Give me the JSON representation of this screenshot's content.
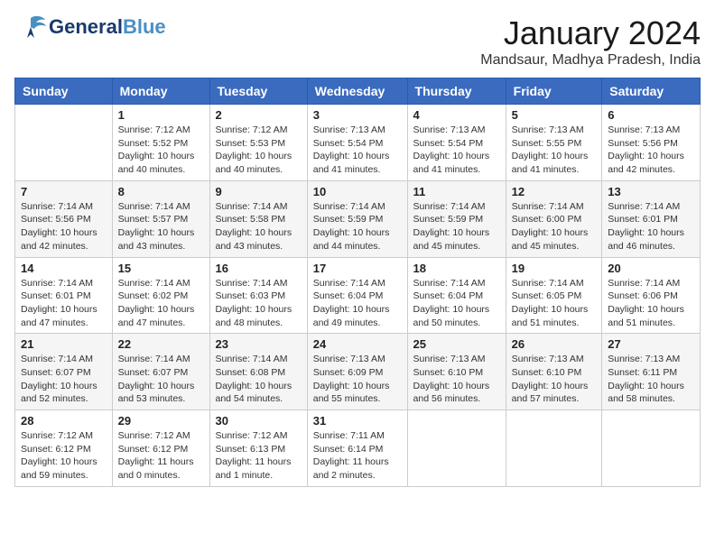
{
  "logo": {
    "line1": "General",
    "line2": "Blue"
  },
  "title": "January 2024",
  "location": "Mandsaur, Madhya Pradesh, India",
  "headers": [
    "Sunday",
    "Monday",
    "Tuesday",
    "Wednesday",
    "Thursday",
    "Friday",
    "Saturday"
  ],
  "weeks": [
    [
      {
        "day": "",
        "info": ""
      },
      {
        "day": "1",
        "info": "Sunrise: 7:12 AM\nSunset: 5:52 PM\nDaylight: 10 hours\nand 40 minutes."
      },
      {
        "day": "2",
        "info": "Sunrise: 7:12 AM\nSunset: 5:53 PM\nDaylight: 10 hours\nand 40 minutes."
      },
      {
        "day": "3",
        "info": "Sunrise: 7:13 AM\nSunset: 5:54 PM\nDaylight: 10 hours\nand 41 minutes."
      },
      {
        "day": "4",
        "info": "Sunrise: 7:13 AM\nSunset: 5:54 PM\nDaylight: 10 hours\nand 41 minutes."
      },
      {
        "day": "5",
        "info": "Sunrise: 7:13 AM\nSunset: 5:55 PM\nDaylight: 10 hours\nand 41 minutes."
      },
      {
        "day": "6",
        "info": "Sunrise: 7:13 AM\nSunset: 5:56 PM\nDaylight: 10 hours\nand 42 minutes."
      }
    ],
    [
      {
        "day": "7",
        "info": "Sunrise: 7:14 AM\nSunset: 5:56 PM\nDaylight: 10 hours\nand 42 minutes."
      },
      {
        "day": "8",
        "info": "Sunrise: 7:14 AM\nSunset: 5:57 PM\nDaylight: 10 hours\nand 43 minutes."
      },
      {
        "day": "9",
        "info": "Sunrise: 7:14 AM\nSunset: 5:58 PM\nDaylight: 10 hours\nand 43 minutes."
      },
      {
        "day": "10",
        "info": "Sunrise: 7:14 AM\nSunset: 5:59 PM\nDaylight: 10 hours\nand 44 minutes."
      },
      {
        "day": "11",
        "info": "Sunrise: 7:14 AM\nSunset: 5:59 PM\nDaylight: 10 hours\nand 45 minutes."
      },
      {
        "day": "12",
        "info": "Sunrise: 7:14 AM\nSunset: 6:00 PM\nDaylight: 10 hours\nand 45 minutes."
      },
      {
        "day": "13",
        "info": "Sunrise: 7:14 AM\nSunset: 6:01 PM\nDaylight: 10 hours\nand 46 minutes."
      }
    ],
    [
      {
        "day": "14",
        "info": "Sunrise: 7:14 AM\nSunset: 6:01 PM\nDaylight: 10 hours\nand 47 minutes."
      },
      {
        "day": "15",
        "info": "Sunrise: 7:14 AM\nSunset: 6:02 PM\nDaylight: 10 hours\nand 47 minutes."
      },
      {
        "day": "16",
        "info": "Sunrise: 7:14 AM\nSunset: 6:03 PM\nDaylight: 10 hours\nand 48 minutes."
      },
      {
        "day": "17",
        "info": "Sunrise: 7:14 AM\nSunset: 6:04 PM\nDaylight: 10 hours\nand 49 minutes."
      },
      {
        "day": "18",
        "info": "Sunrise: 7:14 AM\nSunset: 6:04 PM\nDaylight: 10 hours\nand 50 minutes."
      },
      {
        "day": "19",
        "info": "Sunrise: 7:14 AM\nSunset: 6:05 PM\nDaylight: 10 hours\nand 51 minutes."
      },
      {
        "day": "20",
        "info": "Sunrise: 7:14 AM\nSunset: 6:06 PM\nDaylight: 10 hours\nand 51 minutes."
      }
    ],
    [
      {
        "day": "21",
        "info": "Sunrise: 7:14 AM\nSunset: 6:07 PM\nDaylight: 10 hours\nand 52 minutes."
      },
      {
        "day": "22",
        "info": "Sunrise: 7:14 AM\nSunset: 6:07 PM\nDaylight: 10 hours\nand 53 minutes."
      },
      {
        "day": "23",
        "info": "Sunrise: 7:14 AM\nSunset: 6:08 PM\nDaylight: 10 hours\nand 54 minutes."
      },
      {
        "day": "24",
        "info": "Sunrise: 7:13 AM\nSunset: 6:09 PM\nDaylight: 10 hours\nand 55 minutes."
      },
      {
        "day": "25",
        "info": "Sunrise: 7:13 AM\nSunset: 6:10 PM\nDaylight: 10 hours\nand 56 minutes."
      },
      {
        "day": "26",
        "info": "Sunrise: 7:13 AM\nSunset: 6:10 PM\nDaylight: 10 hours\nand 57 minutes."
      },
      {
        "day": "27",
        "info": "Sunrise: 7:13 AM\nSunset: 6:11 PM\nDaylight: 10 hours\nand 58 minutes."
      }
    ],
    [
      {
        "day": "28",
        "info": "Sunrise: 7:12 AM\nSunset: 6:12 PM\nDaylight: 10 hours\nand 59 minutes."
      },
      {
        "day": "29",
        "info": "Sunrise: 7:12 AM\nSunset: 6:12 PM\nDaylight: 11 hours\nand 0 minutes."
      },
      {
        "day": "30",
        "info": "Sunrise: 7:12 AM\nSunset: 6:13 PM\nDaylight: 11 hours\nand 1 minute."
      },
      {
        "day": "31",
        "info": "Sunrise: 7:11 AM\nSunset: 6:14 PM\nDaylight: 11 hours\nand 2 minutes."
      },
      {
        "day": "",
        "info": ""
      },
      {
        "day": "",
        "info": ""
      },
      {
        "day": "",
        "info": ""
      }
    ]
  ]
}
